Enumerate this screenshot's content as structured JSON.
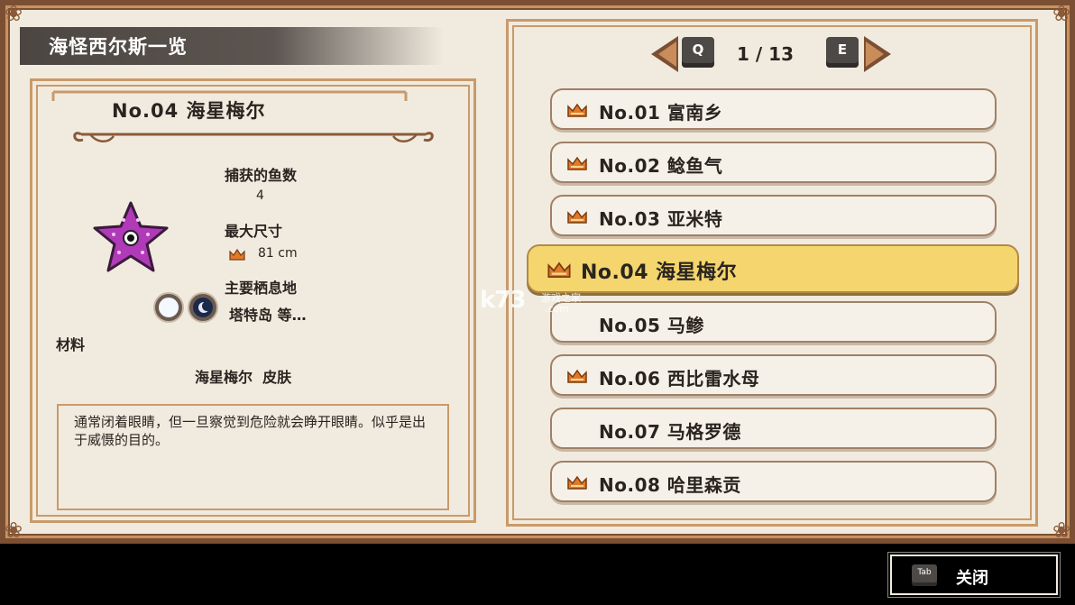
{
  "header": {
    "title": "海怪西尔斯一览"
  },
  "detail": {
    "name": "No.04 海星梅尔",
    "caught_label": "捕获的鱼数",
    "caught_value": "4",
    "max_size_label": "最大尺寸",
    "max_size_value": "81 cm",
    "habitat_label": "主要栖息地",
    "habitat_value": "塔特岛 等…",
    "material_label": "材料",
    "material_value": "海星梅尔  皮肤",
    "description": "通常闭着眼睛，但一旦察觉到危险就会睁开眼睛。似乎是出于威慑的目的。"
  },
  "pager": {
    "prev_key": "Q",
    "next_key": "E",
    "page_text": "1 / 13"
  },
  "list": [
    {
      "label": "No.01 富南乡",
      "crown": true,
      "selected": false
    },
    {
      "label": "No.02 鲶鱼气",
      "crown": true,
      "selected": false
    },
    {
      "label": "No.03 亚米特",
      "crown": true,
      "selected": false
    },
    {
      "label": "No.04 海星梅尔",
      "crown": true,
      "selected": true
    },
    {
      "label": "No.05 马鲹",
      "crown": false,
      "selected": false
    },
    {
      "label": "No.06 西比雷水母",
      "crown": true,
      "selected": false
    },
    {
      "label": "No.07 马格罗德",
      "crown": false,
      "selected": false
    },
    {
      "label": "No.08 哈里森贡",
      "crown": true,
      "selected": false
    }
  ],
  "watermark": {
    "brand": "k73",
    "sub": "游戏之家",
    "domain": ".com"
  },
  "footer": {
    "tab_key": "Tab",
    "close_label": "关闭"
  },
  "colors": {
    "frame": "#7b4f33",
    "parchment": "#f1ebdf",
    "accent_border": "#c99a6a",
    "selected_row": "#f4d56e",
    "starfish": "#b03ab8"
  },
  "icons": [
    "crown-icon",
    "starfish-sprite",
    "chevron-left-icon",
    "chevron-right-icon",
    "day-icon",
    "night-icon"
  ]
}
